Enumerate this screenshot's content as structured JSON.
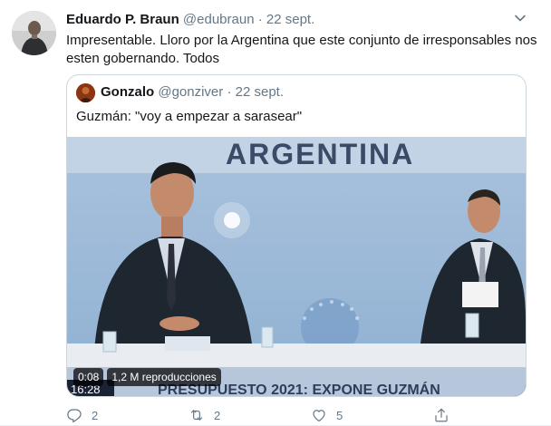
{
  "tweet": {
    "author_name": "Eduardo P. Braun",
    "author_handle": "@edubraun",
    "separator": "·",
    "time": "22 sept.",
    "text": "Impresentable. Lloro por la Argentina que este conjunto de irresponsables nos esten gobernando. Todos",
    "avatar_icon": "profile-photo"
  },
  "quoted_tweet": {
    "author_name": "Gonzalo",
    "author_handle": "@gonziver",
    "separator": "·",
    "time": "22 sept.",
    "text": "Guzmán: \"voy a empezar a sarasear\"",
    "video": {
      "banner_top": "ARGENTINA",
      "banner_bottom": "PRESUPUESTO 2021: EXPONE GUZMÁN",
      "duration": "0:08",
      "views": "1,2 M reproducciones",
      "clock": "16:28"
    }
  },
  "actions": {
    "reply_count": "2",
    "retweet_count": "2",
    "like_count": "5",
    "icons": [
      "reply-icon",
      "retweet-icon",
      "like-icon",
      "share-icon"
    ]
  },
  "colors": {
    "text": "#14171a",
    "secondary": "#657786",
    "border": "#ccd6dd"
  }
}
